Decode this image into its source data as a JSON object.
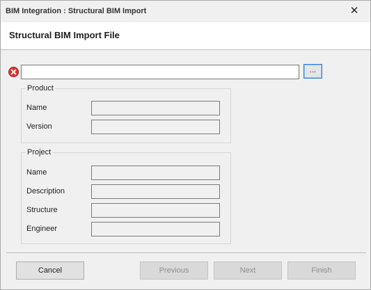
{
  "window": {
    "title": "BIM Integration : Structural BIM Import",
    "close_glyph": "✕"
  },
  "header": {
    "heading": "Structural BIM Import File"
  },
  "file": {
    "path_value": "",
    "browse_label": "...",
    "status_icon": "error-icon",
    "status_color": "#d9342b"
  },
  "product": {
    "legend": "Product",
    "fields": [
      {
        "label": "Name",
        "value": ""
      },
      {
        "label": "Version",
        "value": ""
      }
    ]
  },
  "project": {
    "legend": "Project",
    "fields": [
      {
        "label": "Name",
        "value": ""
      },
      {
        "label": "Description",
        "value": ""
      },
      {
        "label": "Structure",
        "value": ""
      },
      {
        "label": "Engineer",
        "value": ""
      }
    ]
  },
  "footer": {
    "cancel_label": "Cancel",
    "previous_label": "Previous",
    "next_label": "Next",
    "finish_label": "Finish"
  }
}
